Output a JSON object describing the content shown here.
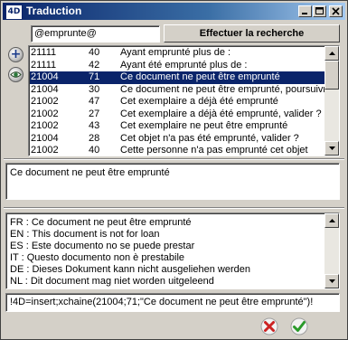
{
  "window": {
    "title": "Traduction",
    "logo": "4D",
    "controls": [
      "minimize-icon",
      "maximize-icon",
      "close-icon"
    ]
  },
  "search": {
    "value": "@emprunte@",
    "button_label": "Effectuer la recherche"
  },
  "side_buttons": [
    {
      "icon": "plus-icon",
      "glyph": "+"
    },
    {
      "icon": "eye-icon"
    }
  ],
  "results": {
    "selected_index": 2,
    "scroll_position": 0.0,
    "rows": [
      {
        "group": "21111",
        "num": "40",
        "text": "Ayant emprunté plus de :"
      },
      {
        "group": "21111",
        "num": "42",
        "text": "Ayant été emprunté plus de :"
      },
      {
        "group": "21004",
        "num": "71",
        "text": "Ce document ne peut être emprunté"
      },
      {
        "group": "21004",
        "num": "30",
        "text": "Ce document ne peut être emprunté, poursuivre"
      },
      {
        "group": "21002",
        "num": "47",
        "text": "Cet exemplaire a déjà été emprunté"
      },
      {
        "group": "21002",
        "num": "27",
        "text": "Cet exemplaire a déjà été emprunté, valider ?"
      },
      {
        "group": "21002",
        "num": "43",
        "text": "Cet exemplaire ne peut être emprunté"
      },
      {
        "group": "21004",
        "num": "28",
        "text": "Cet objet n'a pas été emprunté, valider ?"
      },
      {
        "group": "21002",
        "num": "40",
        "text": "Cette personne n'a pas emprunté cet objet"
      }
    ]
  },
  "detail": {
    "text": "Ce document ne peut être emprunté"
  },
  "translations": [
    "FR : Ce document ne peut être emprunté",
    "EN : This document is not for loan",
    "ES : Este documento no se puede prestar",
    "IT : Questo documento non è prestabile",
    "DE : Dieses Dokument kann nicht ausgeliehen werden",
    "NL : Dit document mag niet worden uitgeleend"
  ],
  "code_line": "!4D=insert;xchaine(21004;71;\"Ce document ne peut être emprunté\")!",
  "actions": {
    "cancel_icon": "cancel-icon",
    "ok_icon": "ok-checkmark-icon"
  },
  "colors": {
    "titlebar": "#0a246a",
    "selection": "#0a246a",
    "face": "#d4d0c8",
    "cancel": "#cc2222",
    "ok": "#2a9a2a"
  }
}
